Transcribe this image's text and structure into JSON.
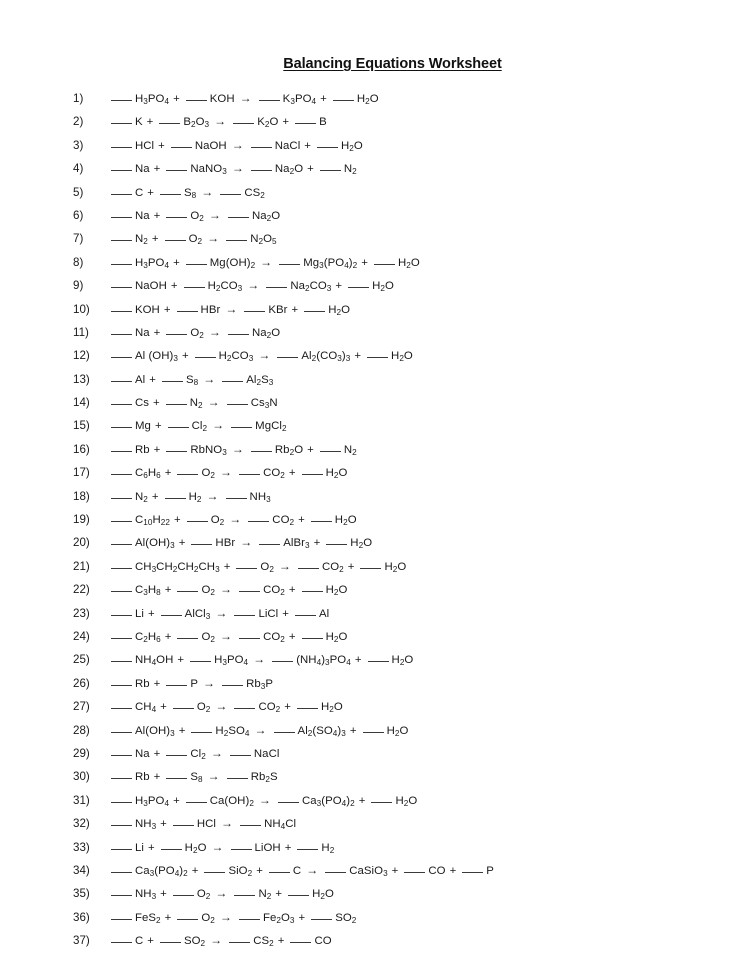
{
  "document": {
    "title": "Balancing Equations Worksheet",
    "arrow_glyph": "→",
    "plus_glyph": "+",
    "blank_glyph": "___",
    "text_color": "#1a1a1a",
    "background_color": "#ffffff"
  },
  "equations": [
    {
      "number": "1)",
      "reactants": [
        "H3PO4",
        "KOH"
      ],
      "products": [
        "K3PO4",
        "H2O"
      ]
    },
    {
      "number": "2)",
      "reactants": [
        "K",
        "B2O3"
      ],
      "products": [
        "K2O",
        "B"
      ]
    },
    {
      "number": "3)",
      "reactants": [
        "HCl",
        "NaOH"
      ],
      "products": [
        "NaCl",
        "H2O"
      ]
    },
    {
      "number": "4)",
      "reactants": [
        "Na",
        "NaNO3"
      ],
      "products": [
        "Na2O",
        "N2"
      ]
    },
    {
      "number": "5)",
      "reactants": [
        "C",
        "S8"
      ],
      "products": [
        "CS2"
      ]
    },
    {
      "number": "6)",
      "reactants": [
        "Na",
        "O2"
      ],
      "products": [
        "Na2O"
      ]
    },
    {
      "number": "7)",
      "reactants": [
        "N2",
        "O2"
      ],
      "products": [
        "N2O5"
      ]
    },
    {
      "number": "8)",
      "reactants": [
        "H3PO4",
        "Mg(OH)2"
      ],
      "products": [
        "Mg3(PO4)2",
        "H2O"
      ]
    },
    {
      "number": "9)",
      "reactants": [
        "NaOH",
        "H2CO3"
      ],
      "products": [
        "Na2CO3",
        "H2O"
      ]
    },
    {
      "number": "10)",
      "reactants": [
        "KOH",
        "HBr"
      ],
      "products": [
        "KBr",
        "H2O"
      ]
    },
    {
      "number": "11)",
      "reactants": [
        "Na",
        "O2"
      ],
      "products": [
        "Na2O"
      ]
    },
    {
      "number": "12)",
      "reactants": [
        "Al (OH)3",
        "H2CO3"
      ],
      "products": [
        "Al2(CO3)3",
        "H2O"
      ]
    },
    {
      "number": "13)",
      "reactants": [
        "Al",
        "S8"
      ],
      "products": [
        "Al2S3"
      ]
    },
    {
      "number": "14)",
      "reactants": [
        "Cs",
        "N2"
      ],
      "products": [
        "Cs3N"
      ]
    },
    {
      "number": "15)",
      "reactants": [
        "Mg",
        "Cl2"
      ],
      "products": [
        "MgCl2"
      ]
    },
    {
      "number": "16)",
      "reactants": [
        "Rb",
        "RbNO3"
      ],
      "products": [
        "Rb2O",
        "N2"
      ]
    },
    {
      "number": "17)",
      "reactants": [
        "C6H6",
        "O2"
      ],
      "products": [
        "CO2",
        "H2O"
      ]
    },
    {
      "number": "18)",
      "reactants": [
        "N2",
        "H2"
      ],
      "products": [
        "NH3"
      ]
    },
    {
      "number": "19)",
      "reactants": [
        "C10H22",
        "O2"
      ],
      "products": [
        "CO2",
        "H2O"
      ]
    },
    {
      "number": "20)",
      "reactants": [
        "Al(OH)3",
        "HBr"
      ],
      "products": [
        "AlBr3",
        "H2O"
      ]
    },
    {
      "number": "21)",
      "reactants": [
        "CH3CH2CH2CH3",
        "O2"
      ],
      "products": [
        "CO2",
        "H2O"
      ]
    },
    {
      "number": "22)",
      "reactants": [
        "C3H8",
        "O2"
      ],
      "products": [
        "CO2",
        "H2O"
      ]
    },
    {
      "number": "23)",
      "reactants": [
        "Li",
        "AlCl3"
      ],
      "products": [
        "LiCl",
        "Al"
      ]
    },
    {
      "number": "24)",
      "reactants": [
        "C2H6",
        "O2"
      ],
      "products": [
        "CO2",
        "H2O"
      ]
    },
    {
      "number": "25)",
      "reactants": [
        "NH4OH",
        "H3PO4"
      ],
      "products": [
        "(NH4)3PO4",
        "H2O"
      ]
    },
    {
      "number": "26)",
      "reactants": [
        "Rb",
        "P"
      ],
      "products": [
        "Rb3P"
      ]
    },
    {
      "number": "27)",
      "reactants": [
        "CH4",
        "O2"
      ],
      "products": [
        "CO2",
        "H2O"
      ]
    },
    {
      "number": "28)",
      "reactants": [
        "Al(OH)3",
        "H2SO4"
      ],
      "products": [
        "Al2(SO4)3",
        "H2O"
      ]
    },
    {
      "number": "29)",
      "reactants": [
        "Na",
        "Cl2"
      ],
      "products": [
        "NaCl"
      ]
    },
    {
      "number": "30)",
      "reactants": [
        "Rb",
        "S8"
      ],
      "products": [
        "Rb2S"
      ]
    },
    {
      "number": "31)",
      "reactants": [
        "H3PO4",
        "Ca(OH)2"
      ],
      "products": [
        "Ca3(PO4)2",
        "H2O"
      ]
    },
    {
      "number": "32)",
      "reactants": [
        "NH3",
        "HCl"
      ],
      "products": [
        "NH4Cl"
      ]
    },
    {
      "number": "33)",
      "reactants": [
        "Li",
        "H2O"
      ],
      "products": [
        "LiOH",
        "H2"
      ]
    },
    {
      "number": "34)",
      "reactants": [
        "Ca3(PO4)2",
        "SiO2",
        "C"
      ],
      "products": [
        "CaSiO3",
        "CO",
        "P"
      ]
    },
    {
      "number": "35)",
      "reactants": [
        "NH3",
        "O2"
      ],
      "products": [
        "N2",
        "H2O"
      ]
    },
    {
      "number": "36)",
      "reactants": [
        "FeS2",
        "O2"
      ],
      "products": [
        "Fe2O3",
        "SO2"
      ]
    },
    {
      "number": "37)",
      "reactants": [
        "C",
        "SO2"
      ],
      "products": [
        "CS2",
        "CO"
      ]
    }
  ]
}
